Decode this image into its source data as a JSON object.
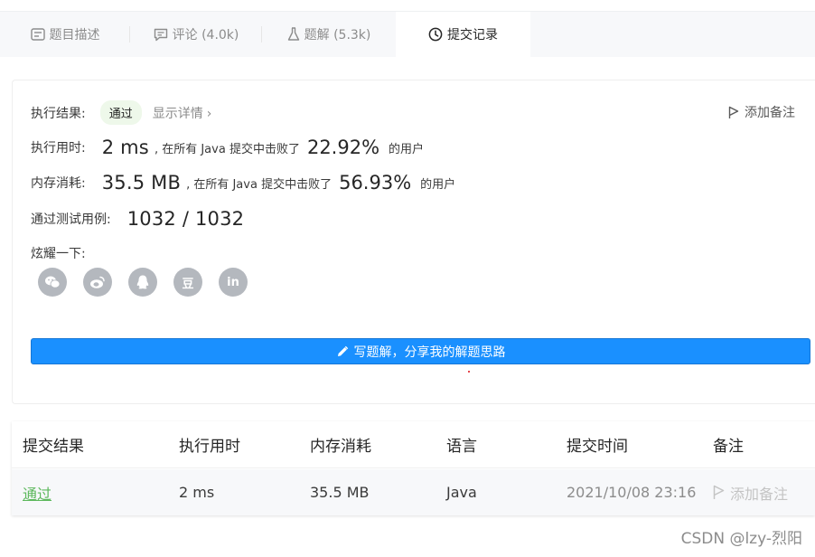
{
  "tabs": [
    {
      "icon": "description-icon",
      "label": "题目描述"
    },
    {
      "icon": "comment-icon",
      "label": "评论 (4.0k)"
    },
    {
      "icon": "flask-icon",
      "label": "题解 (5.3k)"
    },
    {
      "icon": "clock-icon",
      "label": "提交记录",
      "active": true
    }
  ],
  "result": {
    "label": "执行结果:",
    "status": "通过",
    "details_link": "显示详情",
    "add_note": "添加备注",
    "runtime": {
      "label": "执行用时:",
      "value": "2 ms",
      "beat_prefix": ", 在所有 Java 提交中击败了",
      "percent": "22.92%",
      "suffix": "的用户"
    },
    "memory": {
      "label": "内存消耗:",
      "value": "35.5 MB",
      "beat_prefix": ", 在所有 Java 提交中击败了",
      "percent": "56.93%",
      "suffix": "的用户"
    },
    "testcases": {
      "label": "通过测试用例:",
      "value": "1032 / 1032"
    },
    "share_label": "炫耀一下:",
    "share_icons": [
      "wechat-icon",
      "weibo-icon",
      "qq-icon",
      "douban-icon",
      "linkedin-icon"
    ],
    "douban_glyph": "豆",
    "linkedin_glyph": "in",
    "write_button": "写题解，分享我的解题思路"
  },
  "table": {
    "headers": [
      "提交结果",
      "执行用时",
      "内存消耗",
      "语言",
      "提交时间",
      "备注"
    ],
    "rows": [
      {
        "status": "通过",
        "runtime": "2 ms",
        "memory": "35.5 MB",
        "language": "Java",
        "time": "2021/10/08 23:16",
        "note": "添加备注"
      }
    ]
  },
  "watermark": "CSDN @lzy-烈阳",
  "colors": {
    "accent": "#1a90ff",
    "success": "#5cb85c",
    "badge_bg": "#eef8ea"
  }
}
